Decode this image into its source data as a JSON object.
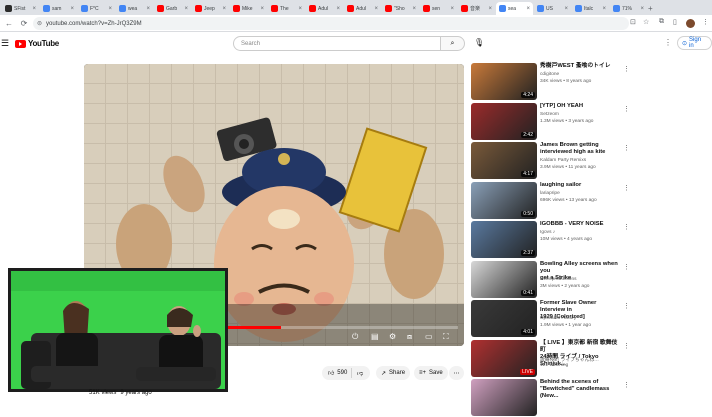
{
  "browser": {
    "tabs": [
      {
        "label": "SFist",
        "color": "#2b2b2b"
      },
      {
        "label": "sam",
        "color": "#4285f4"
      },
      {
        "label": "F*C",
        "color": "#4285f4"
      },
      {
        "label": "wea",
        "color": "#4285f4"
      },
      {
        "label": "Garb",
        "color": "#ff0000"
      },
      {
        "label": "Jeep",
        "color": "#ff0000"
      },
      {
        "label": "Mike",
        "color": "#ff0000"
      },
      {
        "label": "The",
        "color": "#ff0000"
      },
      {
        "label": "Adul",
        "color": "#ff0000"
      },
      {
        "label": "Adul",
        "color": "#ff0000"
      },
      {
        "label": "\"Sho",
        "color": "#ff0000"
      },
      {
        "label": "sen",
        "color": "#ff0000"
      },
      {
        "label": "音楽",
        "color": "#ff0000"
      },
      {
        "label": "sea",
        "color": "#4285f4"
      },
      {
        "label": "US",
        "color": "#4285f4"
      },
      {
        "label": "Italc",
        "color": "#4285f4"
      },
      {
        "label": "71%",
        "color": "#4285f4"
      }
    ],
    "active_tab_index": 13,
    "url": "youtube.com/watch?v=Zh-JrQ3Z9M"
  },
  "youtube": {
    "logo_text": "YouTube",
    "search_placeholder": "Search",
    "sign_in_label": "Sign in"
  },
  "video": {
    "views": "51K views",
    "age": "9 years ago",
    "like_count": "590",
    "share_label": "Share",
    "save_label": "Save",
    "progress": 0.52
  },
  "suggestions": [
    {
      "title": "秀樹戸WEST 蚤喰のトイレ",
      "channel": "cdigitone",
      "meta": "34K views • 8 years ago",
      "duration": "4:24",
      "thumb": "#c97a3a"
    },
    {
      "title": "[YTP] OH YEAH",
      "channel": "Setzeom",
      "meta": "1.3M views • 3 years ago",
      "duration": "2:42",
      "thumb": "#9b2b2b"
    },
    {
      "title": "James Brown getting\ninterviewed high as kite",
      "channel": "Kaldam Party Remixs",
      "meta": "3.9M views • 11 years ago",
      "duration": "4:17",
      "thumb": "#7a5a3a"
    },
    {
      "title": "laughing sailor",
      "channel": "lariapripe",
      "meta": "696K views • 13 years ago",
      "duration": "0:50",
      "thumb": "#8aa0b8"
    },
    {
      "title": "IGOBBB - VERY NOISE",
      "channel": "Igovs ♪",
      "meta": "10M views • 4 years ago",
      "duration": "2:37",
      "thumb": "#5a7aa0"
    },
    {
      "title": "Bowling Alley screens when you\nget a Strike",
      "channel": "Netroproductions",
      "meta": "3M views • 2 years ago",
      "duration": "0:41",
      "thumb": "#d8d8d8"
    },
    {
      "title": "Former Slave Owner Interview in\n1929 [Colorized]",
      "channel": "Upscaled History",
      "meta": "1.9M views • 1 year ago",
      "duration": "4:01",
      "thumb": "#3a3a3a"
    },
    {
      "title": "【 LIVE 】東京都 新宿 歌舞伎町\n24時間 ライブ / Tokyo Shinjuk...",
      "channel": "歌舞伎町 ライブちゃんね…",
      "meta": "121 watching",
      "duration": "LIVE",
      "thumb": "#b03030"
    },
    {
      "title": "Behind the scenes of\n\"Bewitched\" candlemass (New...",
      "channel": "",
      "meta": "",
      "duration": "",
      "thumb": "#d0a0c0"
    }
  ]
}
